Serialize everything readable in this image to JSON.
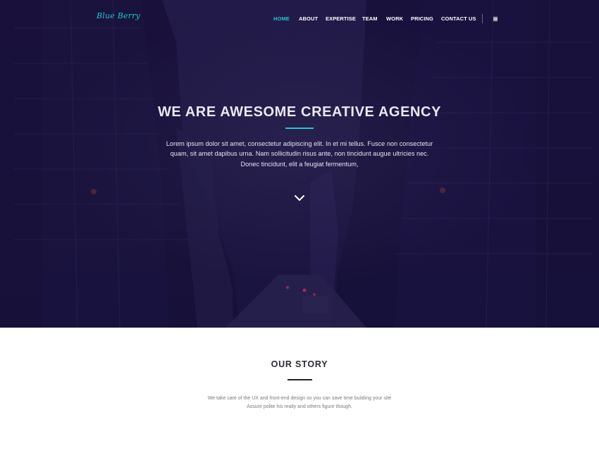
{
  "brand": {
    "logo": "Blue Berry",
    "accent": "#22c7d0",
    "hero_bg": "#1e1743"
  },
  "nav": {
    "items": [
      {
        "label": "HOME",
        "active": true
      },
      {
        "label": "ABOUT",
        "active": false
      },
      {
        "label": "EXPERTISE",
        "active": false
      },
      {
        "label": "TEAM",
        "active": false
      },
      {
        "label": "WORK",
        "active": false
      },
      {
        "label": "PRICING",
        "active": false
      },
      {
        "label": "CONTACT US",
        "active": false
      }
    ],
    "menu_icon": "hamburger-menu-icon"
  },
  "hero": {
    "title": "WE ARE AWESOME CREATIVE AGENCY",
    "text": "Lorem ipsum dolor sit amet, consectetur adipiscing elit. In et mi tellus. Fusce non consectetur quam, sit amet dapibus urna. Nam sollicitudin risus ante, non tincidunt augue ultricies nec. Donec tincidunt, elit a feugiat fermentum,",
    "scroll_icon": "chevron-down-icon"
  },
  "story": {
    "title": "OUR STORY",
    "line1": "We take care of the UX and front-end design so you can save time building your site",
    "line2": "Assure polite his really and others figure though."
  }
}
